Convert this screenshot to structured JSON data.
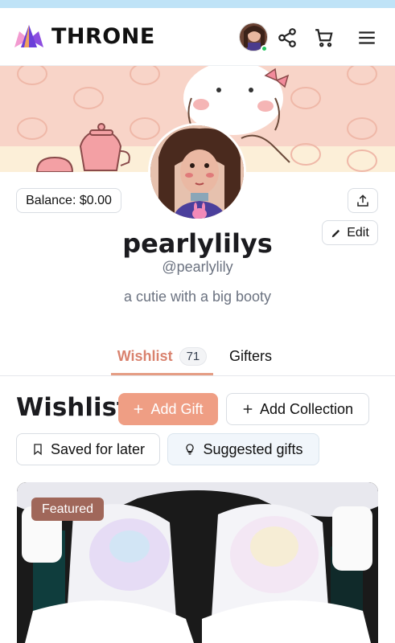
{
  "brand": {
    "name": "THRONE"
  },
  "icons": {
    "share": "share-nodes-icon",
    "cart": "cart-icon",
    "menu": "hamburger-menu-icon",
    "upload": "upload-share-icon",
    "edit": "pencil-icon",
    "plus": "plus-icon",
    "bookmark": "bookmark-icon",
    "bulb": "lightbulb-icon"
  },
  "colors": {
    "accent": "#ef9e84",
    "tab_active": "#d9826e",
    "online": "#22c55e",
    "featured": "#a0675a"
  },
  "profile": {
    "balance": "Balance: $0.00",
    "name": "pearlylilys",
    "handle": "@pearlylily",
    "bio": "a cutie with a big booty",
    "edit_label": "Edit"
  },
  "tabs": [
    {
      "label": "Wishlist",
      "count": "71",
      "active": true
    },
    {
      "label": "Gifters",
      "active": false
    }
  ],
  "wishlist": {
    "title": "Wishlist",
    "add_gift_label": "Add Gift",
    "add_collection_label": "Add Collection",
    "saved_label": "Saved for later",
    "suggested_label": "Suggested gifts",
    "featured_label": "Featured"
  }
}
